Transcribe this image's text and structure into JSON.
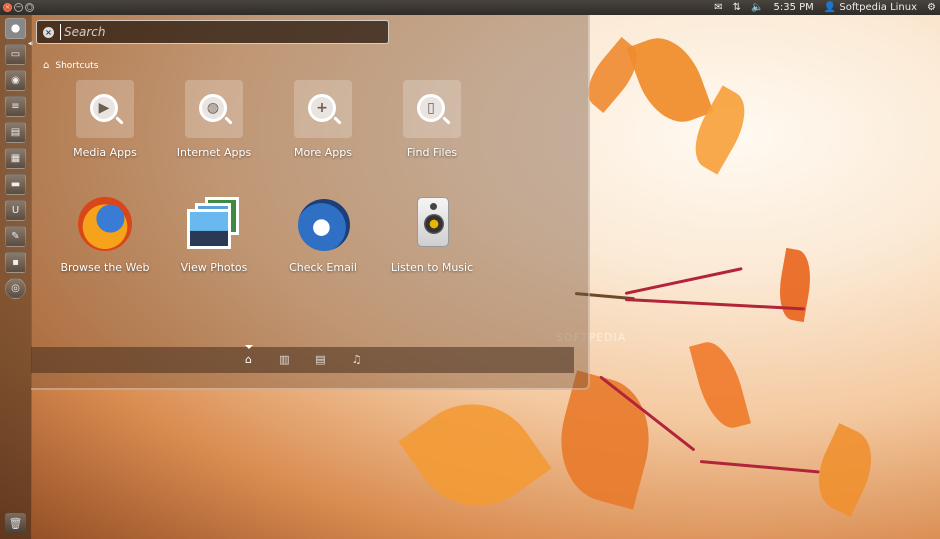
{
  "top_panel": {
    "time": "5:35 PM",
    "user": "Softpedia Linux",
    "icons": [
      "mail-icon",
      "network-icon",
      "volume-icon",
      "user-icon",
      "gear-icon"
    ]
  },
  "launcher": {
    "items": [
      "dash-home-icon",
      "workspace-icon",
      "disk-icon",
      "document-icon",
      "text-editor-icon",
      "spreadsheet-icon",
      "folder-icon",
      "usb-icon",
      "tools-icon",
      "terminal-icon",
      "cd-icon"
    ],
    "trash": "trash-icon"
  },
  "search": {
    "placeholder": "Search"
  },
  "section": {
    "title": "Shortcuts"
  },
  "lenses": [
    {
      "label": "Media Apps",
      "icon": "play-icon"
    },
    {
      "label": "Internet Apps",
      "icon": "globe-icon"
    },
    {
      "label": "More Apps",
      "icon": "plus-icon"
    },
    {
      "label": "Find Files",
      "icon": "document-icon"
    }
  ],
  "apps": [
    {
      "label": "Browse the Web",
      "icon": "firefox-icon"
    },
    {
      "label": "View Photos",
      "icon": "photos-icon"
    },
    {
      "label": "Check Email",
      "icon": "thunderbird-icon"
    },
    {
      "label": "Listen to Music",
      "icon": "speaker-icon"
    }
  ],
  "lens_bar": [
    "home-icon",
    "applications-icon",
    "files-icon",
    "music-icon"
  ],
  "watermark": "SOFTPEDIA",
  "colors": {
    "accent": "#e05a2c",
    "panel": "#3b3631"
  }
}
